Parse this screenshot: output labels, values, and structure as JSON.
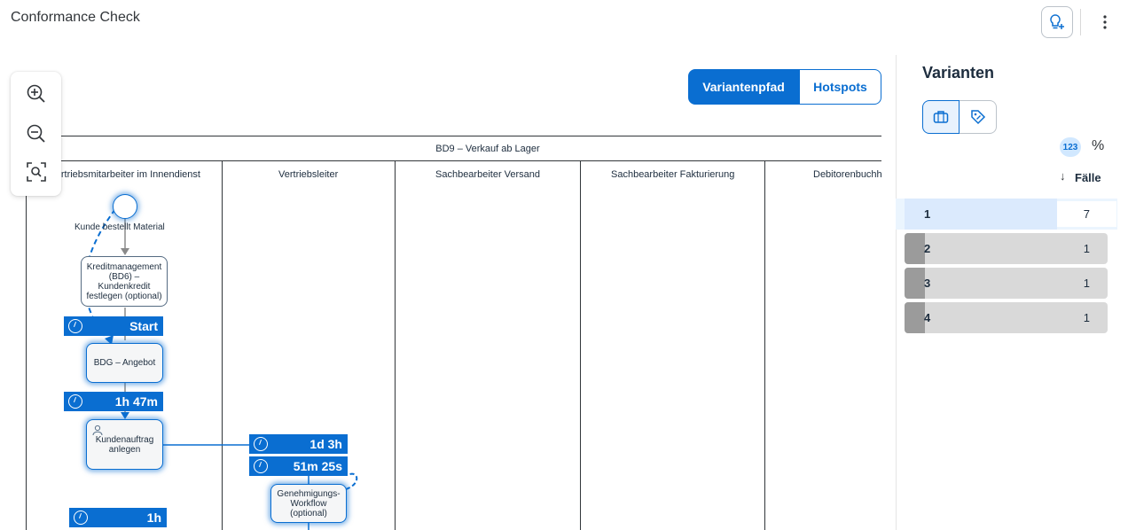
{
  "header": {
    "title": "Conformance Check",
    "ideas_icon": "lightbulb-add-icon",
    "more_icon": "overflow-icon"
  },
  "toolbar": {
    "zoom_in_icon": "zoom-in-icon",
    "zoom_out_icon": "zoom-out-icon",
    "fit_icon": "zoom-fit-icon"
  },
  "view_toggle": {
    "variant_path": "Variantenpfad",
    "hotspots": "Hotspots",
    "selected": "Variantenpfad"
  },
  "diagram": {
    "pool_title": "BD9 – Verkauf ab Lager",
    "lanes": [
      "Vertriebsmitarbeiter im Innendienst",
      "Vertriebsleiter",
      "Sachbearbeiter Versand",
      "Sachbearbeiter Fakturierung",
      "Debitorenbuchh"
    ],
    "start_event": "Kunde bestellt Material",
    "nodes": {
      "credit": "Kreditmanagement (BD6) – Kundenkredit festlegen (optional)",
      "offer": "BDG – Angebot",
      "order": "Kundenauftrag anlegen",
      "approval": "Genehmigungs-Workflow (optional)"
    },
    "tags": {
      "start": "Start",
      "t1": "1h 47m",
      "t2": "1d 3h",
      "t3": "51m 25s",
      "t4": "1h"
    }
  },
  "variants": {
    "title": "Varianten",
    "toggle_icons": [
      "briefcase-icon",
      "tag-icon"
    ],
    "count_badge": "123",
    "percent_symbol": "%",
    "sort_arrow": "↓",
    "column_label": "Fälle",
    "rows": [
      {
        "id": "1",
        "count": "7",
        "fraction": 0.7
      },
      {
        "id": "2",
        "count": "1",
        "fraction": 0.1
      },
      {
        "id": "3",
        "count": "1",
        "fraction": 0.1
      },
      {
        "id": "4",
        "count": "1",
        "fraction": 0.1
      }
    ]
  }
}
